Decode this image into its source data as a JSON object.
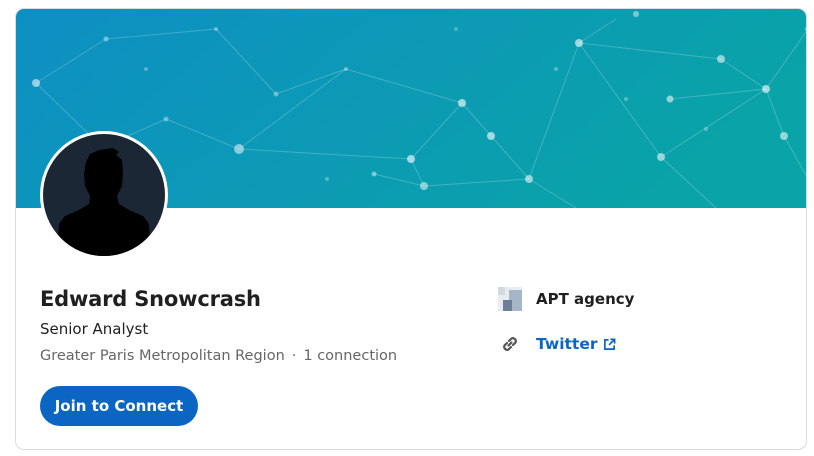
{
  "profile": {
    "name": "Edward Snowcrash",
    "headline": "Senior Analyst",
    "location": "Greater Paris Metropolitan Region",
    "separator": "·",
    "connections": "1 connection",
    "join_label": "Join to Connect"
  },
  "sidebar": {
    "company_name": "APT agency",
    "link_label": "Twitter"
  },
  "colors": {
    "accent": "#0a66c2",
    "banner_start": "#0e8fc4",
    "banner_end": "#0aa3a8",
    "avatar_bg": "#1c2736"
  },
  "icons": {
    "avatar": "person-silhouette-icon",
    "company": "company-logo-icon",
    "link": "link-chain-icon",
    "external": "external-link-icon"
  }
}
